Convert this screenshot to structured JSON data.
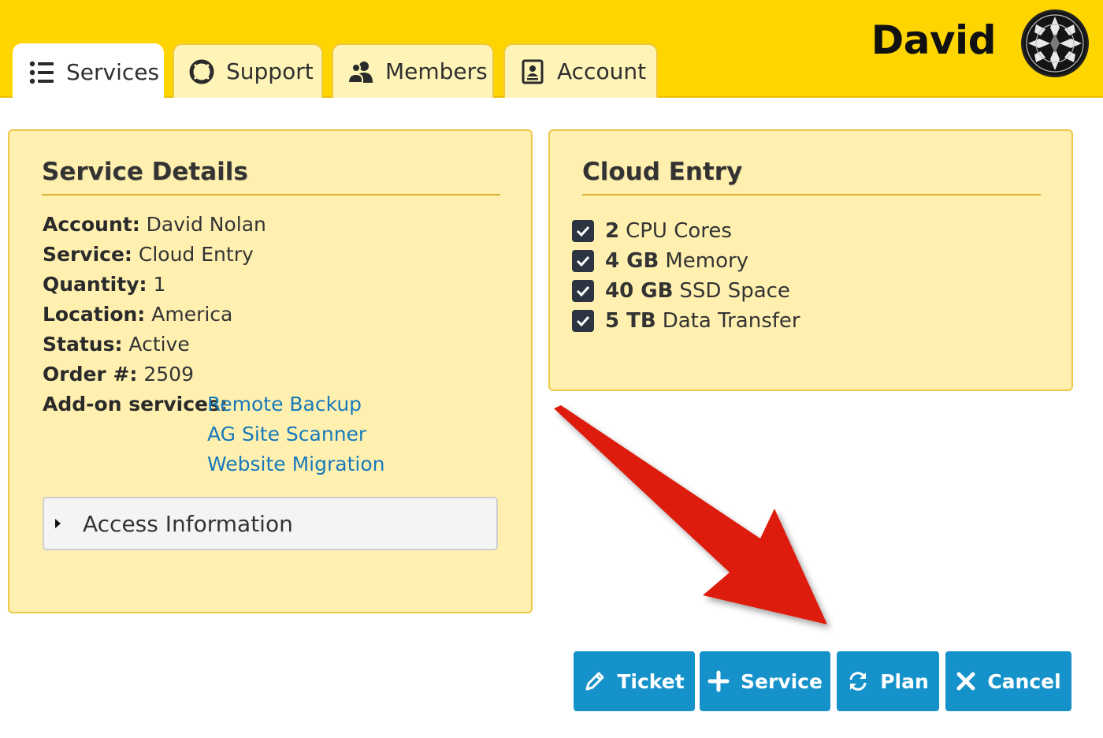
{
  "header": {
    "user_name": "David",
    "tabs": [
      {
        "label": "Services",
        "icon": "list-icon",
        "active": true
      },
      {
        "label": "Support",
        "icon": "lifebuoy-icon",
        "active": false
      },
      {
        "label": "Members",
        "icon": "users-icon",
        "active": false
      },
      {
        "label": "Account",
        "icon": "id-card-icon",
        "active": false
      }
    ]
  },
  "service_details": {
    "title": "Service Details",
    "rows": [
      {
        "label": "Account:",
        "value": "David Nolan"
      },
      {
        "label": "Service:",
        "value": "Cloud Entry"
      },
      {
        "label": "Quantity:",
        "value": "1"
      },
      {
        "label": "Location:",
        "value": "America"
      },
      {
        "label": "Status:",
        "value": "Active"
      },
      {
        "label": "Order #:",
        "value": "2509"
      }
    ],
    "addons_label": "Add-on services:",
    "addons": [
      "Remote Backup",
      "AG Site Scanner",
      "Website Migration"
    ],
    "access_label": "Access Information"
  },
  "plan": {
    "title": "Cloud Entry",
    "features": [
      {
        "amount": "2",
        "text": "CPU Cores"
      },
      {
        "amount": "4 GB",
        "text": "Memory"
      },
      {
        "amount": "40 GB",
        "text": "SSD Space"
      },
      {
        "amount": "5 TB",
        "text": "Data Transfer"
      }
    ]
  },
  "actions": {
    "ticket": "Ticket",
    "service": "Service",
    "plan": "Plan",
    "cancel": "Cancel"
  },
  "colors": {
    "header_yellow": "#ffd500",
    "panel_bg": "#fff0b0",
    "panel_border": "#ecc84a",
    "button_blue": "#1592c9",
    "link_blue": "#1779ba",
    "arrow_red": "#dd1e0a"
  }
}
